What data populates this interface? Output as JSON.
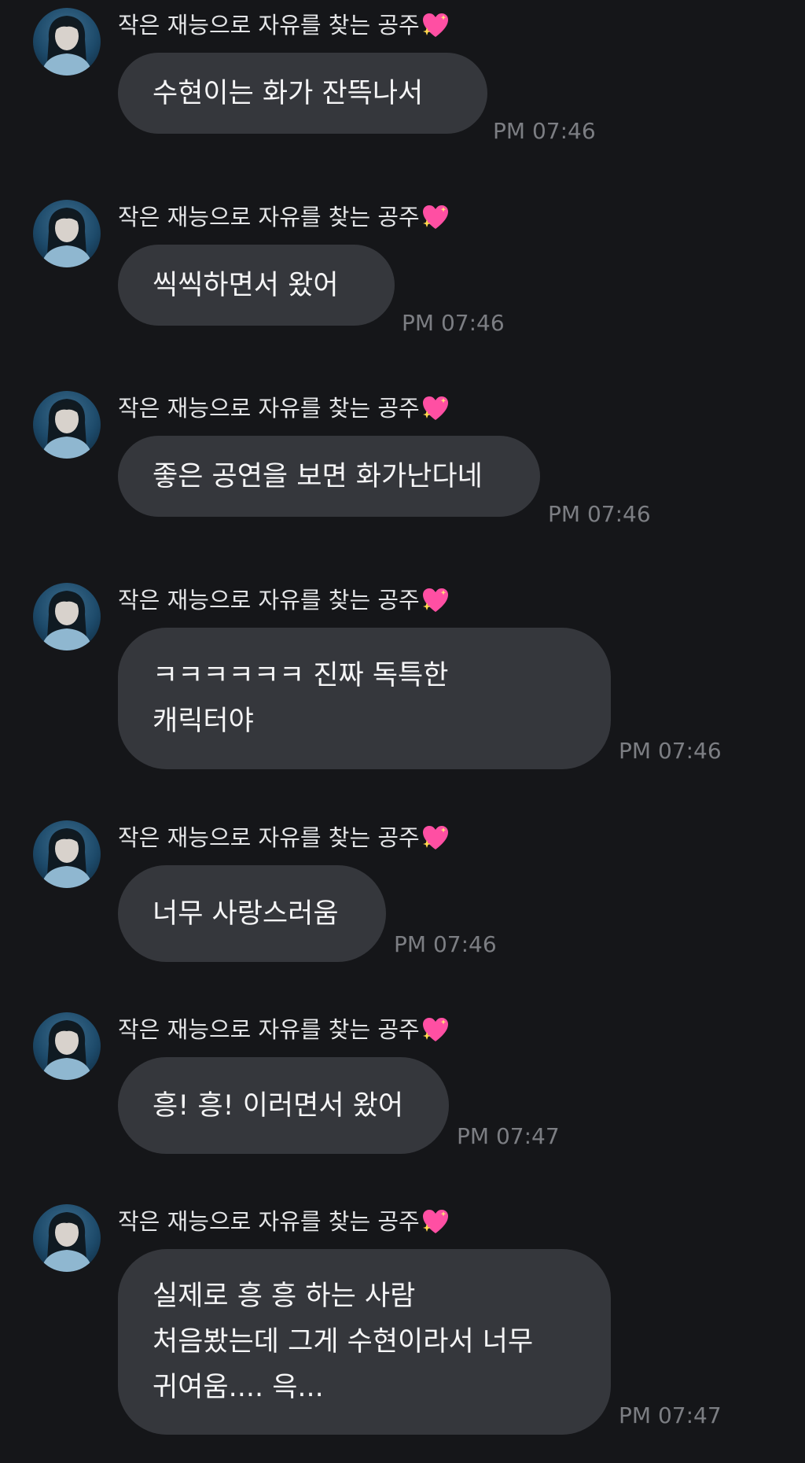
{
  "sender": {
    "name": "작은 재능으로 자유를 찾는 공주",
    "badge_icon": "sparkling-heart-icon"
  },
  "messages": [
    {
      "lines": [
        "수현이는 화가 잔뜩나서"
      ],
      "time": "PM 07:46"
    },
    {
      "lines": [
        "씩씩하면서 왔어"
      ],
      "time": "PM 07:46"
    },
    {
      "lines": [
        "좋은 공연을 보면 화가난다네"
      ],
      "time": "PM 07:46"
    },
    {
      "lines": [
        "ㅋㅋㅋㅋㅋㅋ 진짜 독특한",
        "캐릭터야"
      ],
      "time": "PM 07:46"
    },
    {
      "lines": [
        "너무 사랑스러움"
      ],
      "time": "PM 07:46"
    },
    {
      "lines": [
        "흥! 흥! 이러면서 왔어"
      ],
      "time": "PM 07:47"
    },
    {
      "lines": [
        "실제로 흥 흥 하는 사람",
        "처음봤는데 그게 수현이라서 너무",
        "귀여움.... 윽..."
      ],
      "time": "PM 07:47"
    }
  ],
  "colors": {
    "background": "#151619",
    "bubble": "#35373c",
    "timestamp": "#7c7e83",
    "heart": "#ff4fa3"
  }
}
